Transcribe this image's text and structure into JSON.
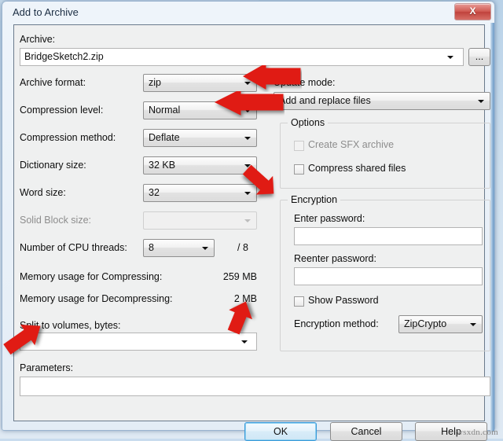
{
  "window": {
    "title": "Add to Archive",
    "close_label": "X",
    "close_icon": "close-icon"
  },
  "archive": {
    "label": "Archive:",
    "value": "BridgeSketch2.zip",
    "browse_label": "..."
  },
  "left_column": {
    "archive_format": {
      "label": "Archive format:",
      "value": "zip"
    },
    "compression_level": {
      "label": "Compression level:",
      "value": "Normal"
    },
    "compression_method": {
      "label": "Compression method:",
      "value": "Deflate"
    },
    "dictionary_size": {
      "label": "Dictionary size:",
      "value": "32 KB"
    },
    "word_size": {
      "label": "Word size:",
      "value": "32"
    },
    "solid_block_size": {
      "label": "Solid Block size:",
      "value": ""
    },
    "cpu_threads": {
      "label": "Number of CPU threads:",
      "value": "8",
      "max": "/ 8"
    },
    "memory_compress": {
      "label": "Memory usage for Compressing:",
      "value": "259 MB"
    },
    "memory_decompress": {
      "label": "Memory usage for Decompressing:",
      "value": "2 MB"
    },
    "split_volumes": {
      "label": "Split to volumes, bytes:",
      "value": ""
    }
  },
  "right_column": {
    "update_mode": {
      "label": "Update mode:",
      "value": "Add and replace files"
    },
    "options": {
      "title": "Options",
      "items": [
        {
          "label": "Create SFX archive",
          "checked": false,
          "disabled": true
        },
        {
          "label": "Compress shared files",
          "checked": false,
          "disabled": false
        }
      ]
    },
    "encryption": {
      "title": "Encryption",
      "enter_password_label": "Enter password:",
      "enter_password_value": "",
      "reenter_password_label": "Reenter password:",
      "reenter_password_value": "",
      "show_password_label": "Show Password",
      "show_password_checked": false,
      "method_label": "Encryption method:",
      "method_value": "ZipCrypto"
    }
  },
  "parameters": {
    "label": "Parameters:",
    "value": ""
  },
  "buttons": {
    "ok": "OK",
    "cancel": "Cancel",
    "help": "Help"
  },
  "watermark": "wsxdn.com",
  "colors": {
    "accent_blue": "#3b9ad9",
    "close_red": "#c0423c",
    "annotation_red": "#e01b14",
    "panel_bg": "#eff0f0"
  }
}
